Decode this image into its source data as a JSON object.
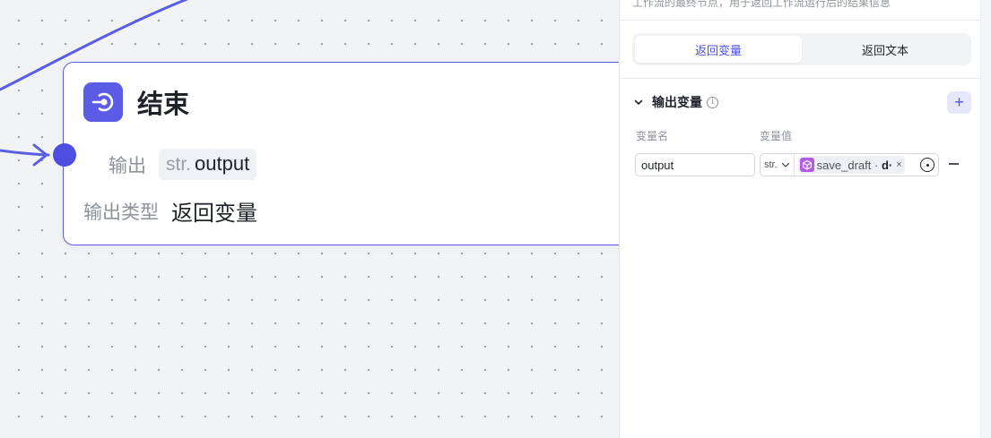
{
  "colors": {
    "accent": "#5b5ce6",
    "edge": "#5a5ee0",
    "canvas_bg": "#f2f3f5",
    "ref_icon": "#b35be8"
  },
  "canvas": {
    "node": {
      "icon": "end-node-icon",
      "title": "结束",
      "output_label": "输出",
      "output_tag_type": "str.",
      "output_tag_name": "output",
      "output_type_label": "输出类型",
      "output_type_value": "返回变量"
    }
  },
  "panel": {
    "description": "工作流的最终节点，用于返回工作流运行后的结果信息",
    "tabs": [
      {
        "label": "返回变量",
        "active": true
      },
      {
        "label": "返回文本",
        "active": false
      }
    ],
    "section": {
      "title": "输出变量",
      "info_icon": "info-icon",
      "add_label": "+"
    },
    "columns": {
      "name": "变量名",
      "value": "变量值"
    },
    "rows": [
      {
        "name": "output",
        "type": "str.",
        "ref_source": "save_draft",
        "ref_sep": " · ",
        "ref_field": "d·",
        "ref_close": "×"
      }
    ]
  }
}
